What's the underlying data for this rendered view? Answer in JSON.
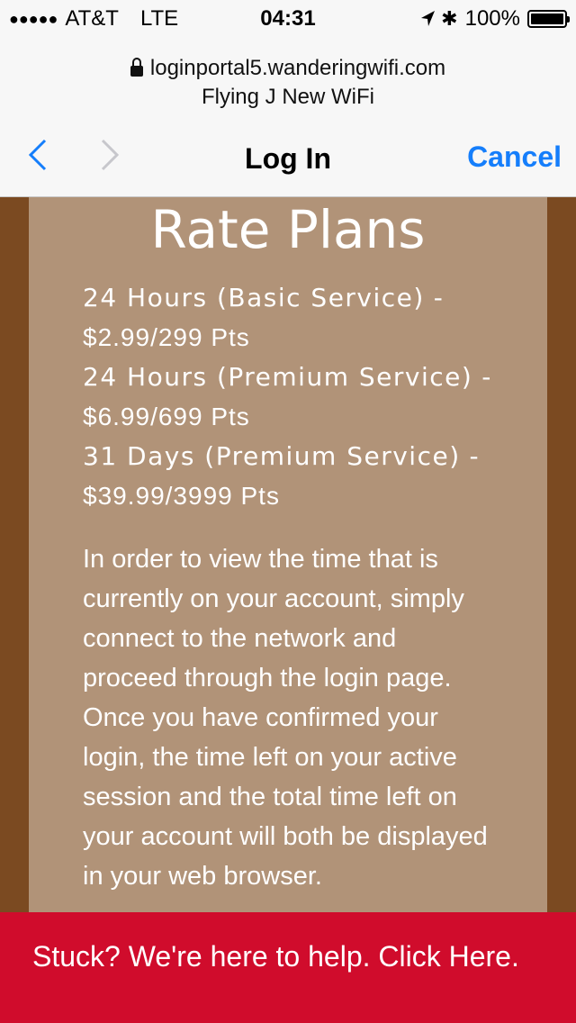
{
  "status_bar": {
    "signal_dots": "●●●●●",
    "carrier": "AT&T",
    "network": "LTE",
    "time": "04:31",
    "battery": "100%",
    "battery_level": 1.0
  },
  "address": {
    "url": "loginportal5.wanderingwifi.com",
    "title": "Flying J New WiFi"
  },
  "nav": {
    "title": "Log In",
    "cancel_label": "Cancel",
    "accent_color": "#157efb"
  },
  "content": {
    "heading": "Rate Plans",
    "plans": [
      {
        "name": "24 Hours (Basic Service)",
        "price": "$2.99/299 Pts"
      },
      {
        "name": "24 Hours (Premium Service)",
        "price": "$6.99/699 Pts"
      },
      {
        "name": "31 Days (Premium Service)",
        "price": "$39.99/3999 Pts"
      }
    ],
    "paragraph": "In order to view the time that is currently on your account, simply connect to the network and proceed through the login page. Once you have confirmed your login, the time left on your active session and the total time left on your account will both be displayed in your web browser."
  },
  "help_bar": {
    "text": "Stuck? We're here to help. Click Here.",
    "color": "#d00c2c"
  }
}
